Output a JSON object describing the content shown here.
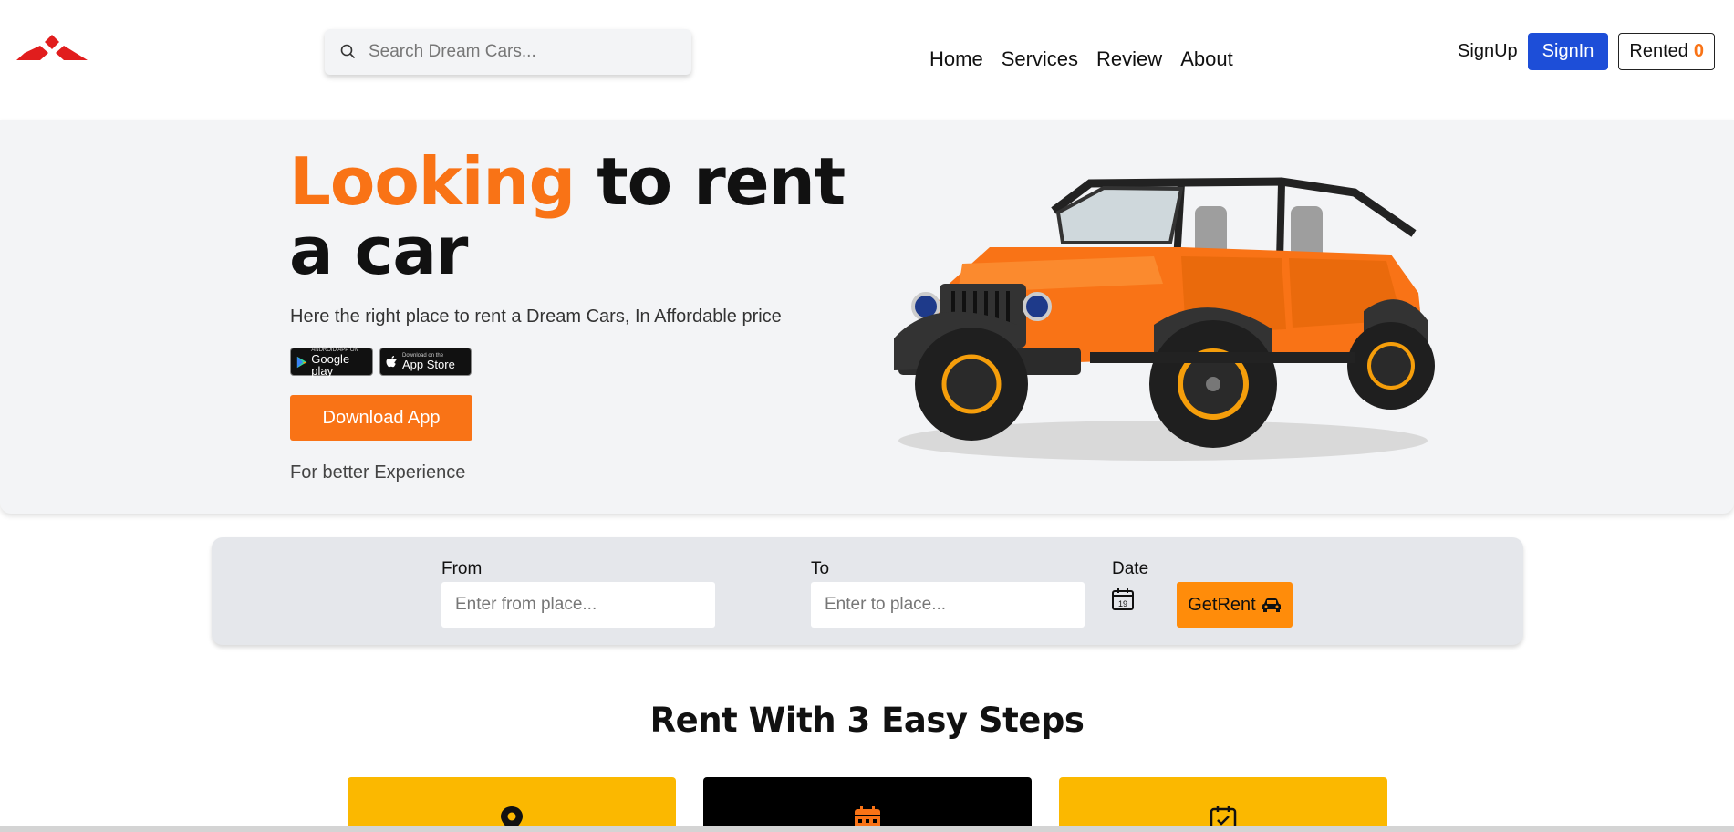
{
  "header": {
    "search": {
      "placeholder": "Search Dream Cars..."
    },
    "nav": [
      "Home",
      "Services",
      "Review",
      "About"
    ],
    "signup_label": "SignUp",
    "signin_label": "SignIn",
    "rented_label": "Rented",
    "rented_count": "0"
  },
  "hero": {
    "title_accent": "Looking",
    "title_rest": " to rent a car",
    "subtitle": "Here the right place to rent a Dream Cars, In Affordable price",
    "badges": {
      "google_small": "ANDROID APP ON",
      "google_big": "Google play",
      "apple_small": "Download on the",
      "apple_big": "App Store"
    },
    "download_label": "Download App",
    "footnote": "For better Experience"
  },
  "booking": {
    "from_label": "From",
    "from_placeholder": "Enter from place...",
    "to_label": "To",
    "to_placeholder": "Enter to place...",
    "date_label": "Date",
    "date_icon_day": "19",
    "getrent_label": "GetRent"
  },
  "steps": {
    "title": "Rent With 3 Easy Steps"
  },
  "colors": {
    "accent": "#f97316",
    "signin": "#1d4ed8",
    "getrent": "#ff8c0a",
    "step_yellow": "#fbb800",
    "step_black": "#000000"
  },
  "icons": [
    "logo-icon",
    "search-icon",
    "calendar-icon",
    "car-icon",
    "location-pin-icon",
    "calendar-days-icon",
    "calendar-check-icon"
  ]
}
